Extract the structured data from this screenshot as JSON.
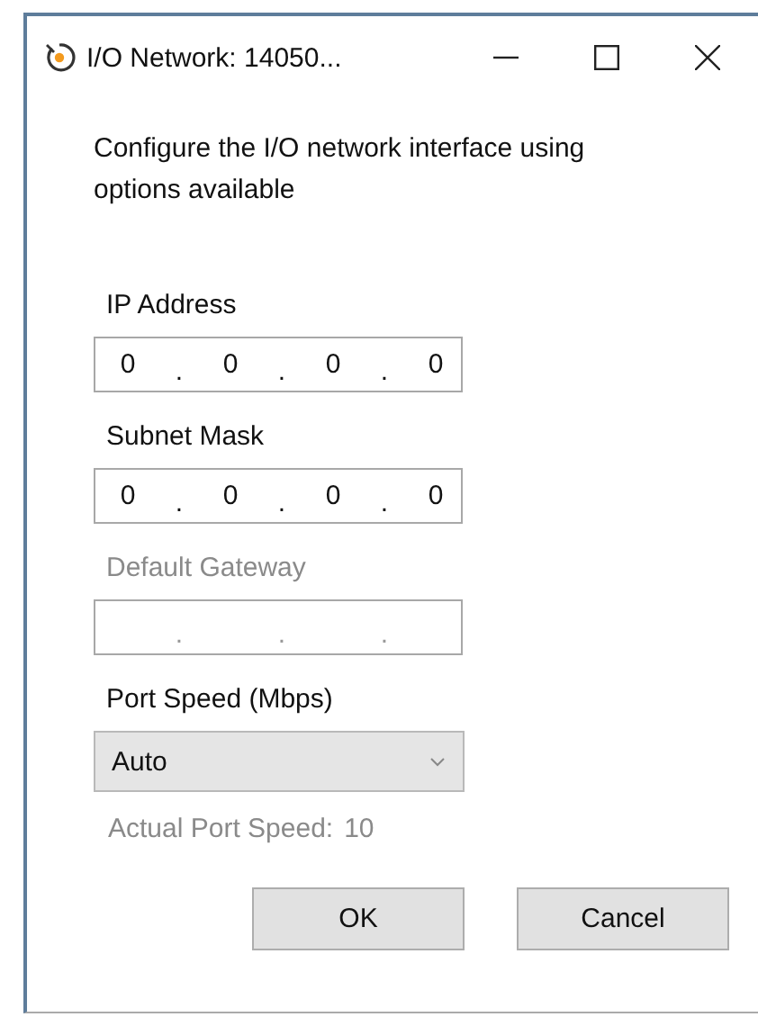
{
  "window": {
    "title": "I/O Network: 14050...",
    "controls": [
      {
        "kind": "minimize"
      },
      {
        "kind": "maximize"
      },
      {
        "kind": "close"
      }
    ]
  },
  "description": "Configure the I/O network interface using options available",
  "address_fields": [
    {
      "label": "IP Address",
      "disabled": false,
      "octets": [
        "0",
        "0",
        "0",
        "0"
      ],
      "separators": [
        ".",
        ".",
        "."
      ]
    },
    {
      "label": "Subnet Mask",
      "disabled": false,
      "octets": [
        "0",
        "0",
        "0",
        "0"
      ],
      "separators": [
        ".",
        ".",
        "."
      ]
    },
    {
      "label": "Default Gateway",
      "disabled": true,
      "separators": [
        ".",
        ".",
        "."
      ]
    }
  ],
  "port_speed": {
    "label": "Port Speed (Mbps)",
    "value": "Auto",
    "actual_label": "Actual Port Speed:",
    "actual_value": "10"
  },
  "buttons": [
    {
      "label": "OK"
    },
    {
      "label": "Cancel"
    }
  ]
}
